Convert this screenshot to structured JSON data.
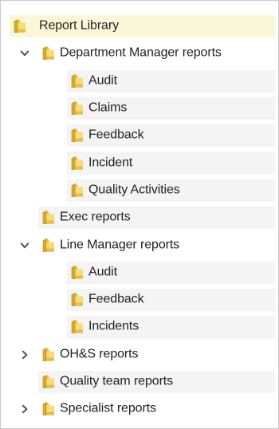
{
  "tree": {
    "root": {
      "label": "Report Library",
      "icon": "folder-icon"
    },
    "department_manager": {
      "label": "Department Manager reports",
      "expanded": true,
      "children": [
        "Audit",
        "Claims",
        "Feedback",
        "Incident",
        "Quality Activities"
      ]
    },
    "exec": {
      "label": "Exec reports"
    },
    "line_manager": {
      "label": "Line Manager reports",
      "expanded": true,
      "children": [
        "Audit",
        "Feedback",
        "Incidents"
      ]
    },
    "ohs": {
      "label": "OH&S reports",
      "expanded": false
    },
    "quality_team": {
      "label": "Quality team reports"
    },
    "specialist": {
      "label": "Specialist reports",
      "expanded": false
    }
  },
  "colors": {
    "root_highlight": "#fbf6d8",
    "row_highlight": "#f4f4f4",
    "folder_body": "#e8c14a",
    "folder_dark": "#c9a02a",
    "folder_light": "#f7e08c"
  }
}
